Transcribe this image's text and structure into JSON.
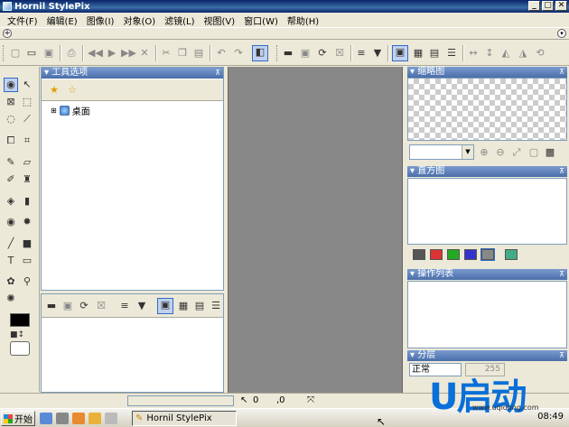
{
  "window": {
    "title": "Hornil StylePix",
    "minimize": "_",
    "maximize": "▢",
    "close": "✕"
  },
  "menu": [
    "文件(F)",
    "编辑(E)",
    "图像(I)",
    "对象(O)",
    "滤镜(L)",
    "视图(V)",
    "窗口(W)",
    "帮助(H)"
  ],
  "strip": {
    "add": "+",
    "more": "▾"
  },
  "panels": {
    "tool_options": "工具选项",
    "thumbnail": "缩略图",
    "histogram": "直方图",
    "operations": "操作列表",
    "layers": "分层"
  },
  "tree": {
    "desktop": "桌面"
  },
  "layers": {
    "blend_mode": "正常",
    "opacity": "255"
  },
  "status": {
    "x": "0",
    "y": ",0"
  },
  "taskbar": {
    "start": "开始",
    "task": "Hornil StylePix",
    "clock": "08:49"
  },
  "logo": {
    "text": "U启动",
    "url": "www.uqidong.com"
  },
  "colors": {
    "foreground": "#000000",
    "background": "#ffffff"
  },
  "icons": {
    "toolbar": [
      "new-icon",
      "open-icon",
      "save-icon",
      "print-icon",
      "first-icon",
      "prev-icon",
      "next-icon",
      "last-icon",
      "close-icon",
      "cut-icon",
      "copy-icon",
      "paste-icon",
      "undo-icon",
      "redo-icon",
      "panel-toggle-icon",
      "folder-icon",
      "image-icon",
      "refresh-icon",
      "stop-icon",
      "add-list-icon",
      "dropdown-icon",
      "large-icons-icon",
      "small-icons-icon",
      "list-icon",
      "details-icon",
      "flip-h-icon",
      "flip-v-icon",
      "rotate-left-icon",
      "rotate-right-icon",
      "rotate-icon"
    ]
  }
}
